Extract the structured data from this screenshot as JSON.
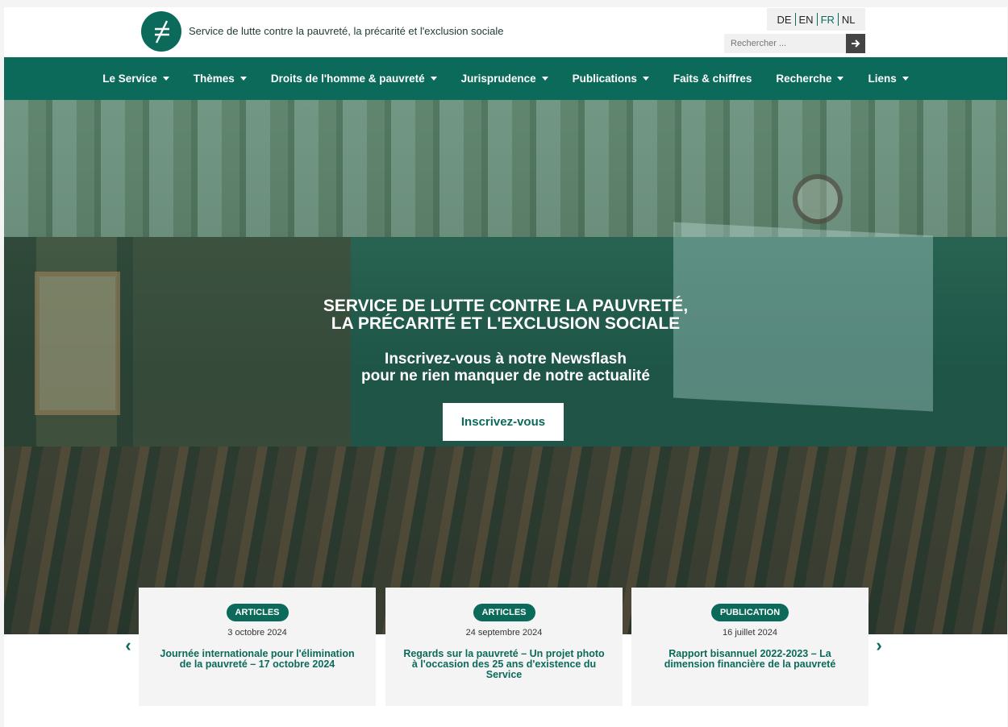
{
  "header": {
    "tagline": "Service de lutte contre la pauvreté, la précarité et l'exclusion sociale",
    "languages": [
      {
        "code": "DE",
        "active": false
      },
      {
        "code": "EN",
        "active": false
      },
      {
        "code": "FR",
        "active": true
      },
      {
        "code": "NL",
        "active": false
      }
    ],
    "search": {
      "placeholder": "Rechercher ..."
    }
  },
  "nav": {
    "items": [
      {
        "label": "Le Service",
        "dropdown": true
      },
      {
        "label": "Thèmes",
        "dropdown": true
      },
      {
        "label": "Droits de l'homme & pauvreté",
        "dropdown": true
      },
      {
        "label": "Jurisprudence",
        "dropdown": true
      },
      {
        "label": "Publications",
        "dropdown": true
      },
      {
        "label": "Faits & chiffres",
        "dropdown": false
      },
      {
        "label": "Recherche",
        "dropdown": true
      },
      {
        "label": "Liens",
        "dropdown": true
      }
    ]
  },
  "hero": {
    "title_line1": "SERVICE DE LUTTE CONTRE LA PAUVRETÉ,",
    "title_line2": "LA PRÉCARITÉ ET L'EXCLUSION SOCIALE",
    "subtitle_line1": "Inscrivez-vous à notre Newsflash",
    "subtitle_line2": "pour ne rien manquer de notre actualité",
    "button_label": "Inscrivez-vous"
  },
  "cards": [
    {
      "badge": "ARTICLES",
      "date": "3 octobre 2024",
      "title": "Journée internationale pour l'élimination de la pauvreté – 17 octobre 2024"
    },
    {
      "badge": "ARTICLES",
      "date": "24 septembre 2024",
      "title": "Regards sur la pauvreté – Un projet photo à l'occasion des 25 ans d'existence du Service"
    },
    {
      "badge": "PUBLICATION",
      "date": "16 juillet 2024",
      "title": "Rapport bisannuel 2022-2023 – La dimension financière de la pauvreté"
    }
  ],
  "carousel": {
    "prev_glyph": "‹",
    "next_glyph": "›"
  },
  "colors": {
    "brand": "#0b6a5a",
    "white": "#ffffff",
    "card_bg": "#f4f4f4"
  }
}
